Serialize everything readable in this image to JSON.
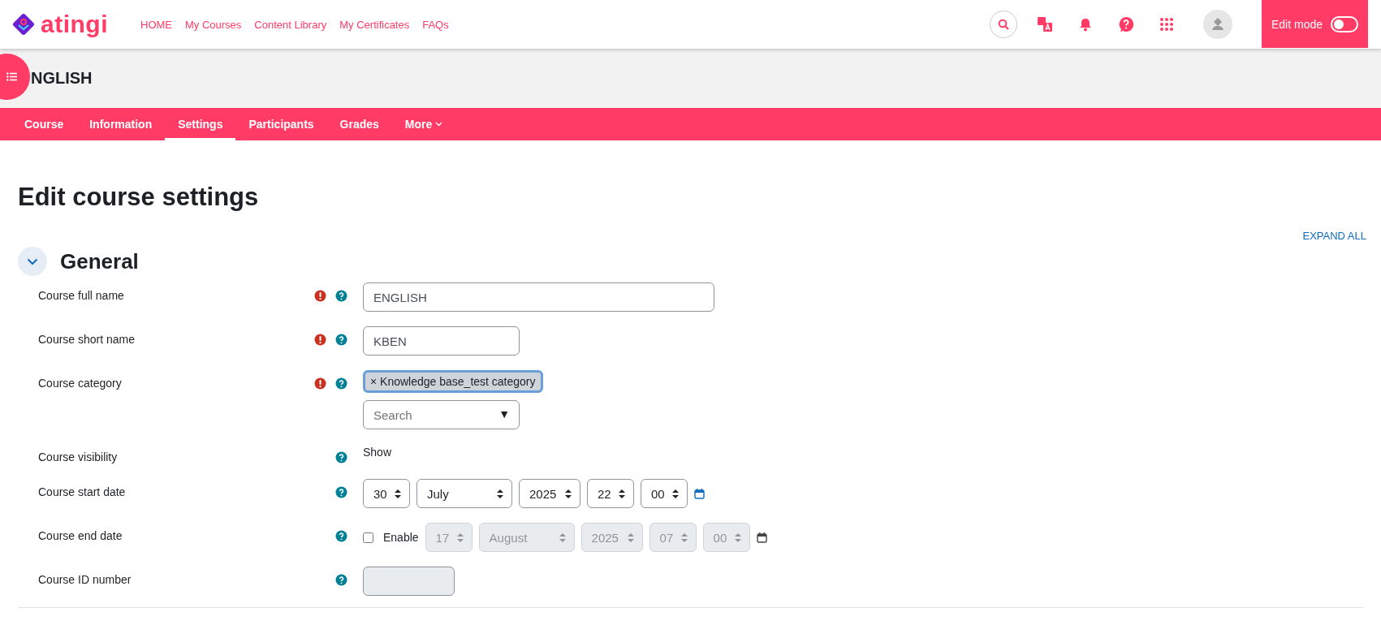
{
  "header": {
    "logo_text": "atingi",
    "nav": [
      "HOME",
      "My Courses",
      "Content Library",
      "My Certificates",
      "FAQs"
    ],
    "edit_mode": {
      "label": "Edit mode",
      "on": false
    }
  },
  "course_title": "NGLISH",
  "tabs": [
    {
      "label": "Course",
      "selected": false
    },
    {
      "label": "Information",
      "selected": false
    },
    {
      "label": "Settings",
      "selected": true
    },
    {
      "label": "Participants",
      "selected": false
    },
    {
      "label": "Grades",
      "selected": false
    },
    {
      "label": "More",
      "selected": false
    }
  ],
  "page_title": "Edit course settings",
  "expand_all": "EXPAND ALL",
  "section": {
    "title": "General",
    "expanded": true
  },
  "fields": [
    {
      "kind": "wide_text",
      "label": "Course full name",
      "required": true,
      "value": "ENGLISH"
    },
    {
      "kind": "short_text",
      "label": "Course short name",
      "required": true,
      "value": "KBEN"
    },
    {
      "kind": "autocomplete",
      "label": "Course category",
      "required": true,
      "chip": "× Knowledge base_test category",
      "placeholder": "Search",
      "caret": "▼"
    },
    {
      "kind": "static",
      "label": "Course visibility",
      "required": false,
      "value": "Show"
    },
    {
      "kind": "date",
      "label": "Course start date",
      "required": false,
      "parts": [
        "30",
        "July",
        "2025",
        "22",
        "00"
      ]
    },
    {
      "kind": "date_optional",
      "label": "Course end date",
      "required": false,
      "enable_label": "Enable",
      "checked": false,
      "parts": [
        "17",
        "August",
        "2025",
        "07",
        "00"
      ]
    },
    {
      "kind": "id_text",
      "label": "Course ID number",
      "required": false
    }
  ]
}
